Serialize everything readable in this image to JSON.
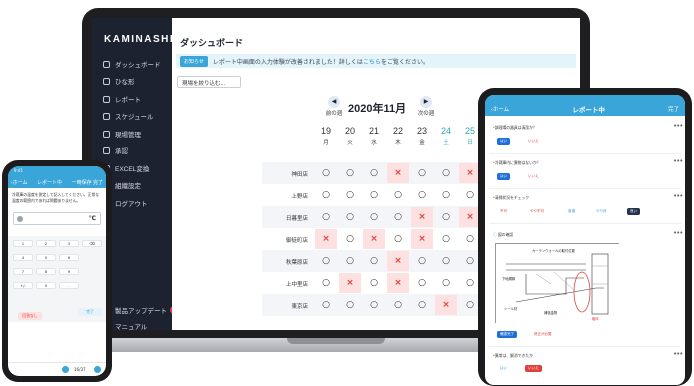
{
  "laptop": {
    "brand": "KAMINASHI",
    "nav": [
      "ダッシュボード",
      "ひな形",
      "レポート",
      "スケジュール",
      "現場管理",
      "承認",
      "EXCEL変換",
      "組織設定",
      "ログアウト",
      "製品アップデート",
      "マニュアル"
    ],
    "update_badge": "3",
    "page_title": "ダッシュボード",
    "notice": {
      "tag": "お知らせ",
      "text": "レポート中画面の入力体験が改善されました！詳しくは",
      "link": "こちら",
      "tail": "をご覧ください。"
    },
    "filter_label": "現場を絞り込む...",
    "prev_week": "前の週",
    "next_week": "次の週",
    "month_label": "2020年11月",
    "days": [
      {
        "d": "19",
        "w": "月"
      },
      {
        "d": "20",
        "w": "火"
      },
      {
        "d": "21",
        "w": "水"
      },
      {
        "d": "22",
        "w": "木"
      },
      {
        "d": "23",
        "w": "金"
      },
      {
        "d": "24",
        "w": "土"
      },
      {
        "d": "25",
        "w": "日"
      }
    ],
    "rows": [
      {
        "name": "神田店",
        "cells": [
          "○",
          "○",
          "○",
          "×",
          "○",
          "○",
          "×"
        ]
      },
      {
        "name": "上野店",
        "cells": [
          "○",
          "○",
          "○",
          "○",
          "○",
          "○",
          "○"
        ]
      },
      {
        "name": "日暮里店",
        "cells": [
          "○",
          "○",
          "○",
          "○",
          "×",
          "○",
          "×"
        ]
      },
      {
        "name": "御徒町店",
        "cells": [
          "×",
          "○",
          "×",
          "○",
          "×",
          "○",
          "○"
        ]
      },
      {
        "name": "秋葉原店",
        "cells": [
          "○",
          "○",
          "○",
          "×",
          "○",
          "○",
          "○"
        ]
      },
      {
        "name": "上中里店",
        "cells": [
          "○",
          "×",
          "○",
          "×",
          "○",
          "○",
          "○"
        ]
      },
      {
        "name": "東京店",
        "cells": [
          "○",
          "○",
          "○",
          "○",
          "○",
          "×",
          "○"
        ]
      }
    ]
  },
  "phone": {
    "status_time": "9:41",
    "back": "ホーム",
    "title": "レポート中",
    "action1": "一時保存",
    "action2": "完了",
    "question": "冷蔵庫の温度を測定して記入してください。正常な温度の範囲内であれば問題ありません。",
    "unit": "℃",
    "keys": [
      "1",
      "2",
      "3",
      "⌫",
      "4",
      "5",
      "6",
      "7",
      "8",
      "9",
      "+/-",
      "0",
      "."
    ],
    "cancel": "回答なし",
    "done": "完了",
    "page": "16/37"
  },
  "tablet": {
    "back": "ホーム",
    "title": "レポート中",
    "action": "完了",
    "q1": "調理場の器具は清潔か？",
    "q1_yes": "はい",
    "q1_no": "いいえ",
    "q2": "冷蔵庫内に異物はないか？",
    "q2_yes": "はい",
    "q2_no": "いいえ",
    "q3": "清掃状況をチェック",
    "q3_opts": [
      "不可",
      "やや不可",
      "普通",
      "やや良",
      "良い"
    ],
    "q4": "図の確認",
    "drawing_notes": [
      "カーテンウォールの取付位置",
      "下地胴縁",
      "シール材",
      "補強金物",
      "躯体"
    ],
    "q4_ok": "確認完了",
    "q4_ng": "修正が必要",
    "q5": "異常は、解消できたか",
    "q5_yes": "はい",
    "q5_no": "いいえ"
  },
  "colors": {
    "accent": "#3aa5d8",
    "sidebar": "#1c2230",
    "ng": "#e0403a",
    "weekend": "#2fa7b8"
  }
}
